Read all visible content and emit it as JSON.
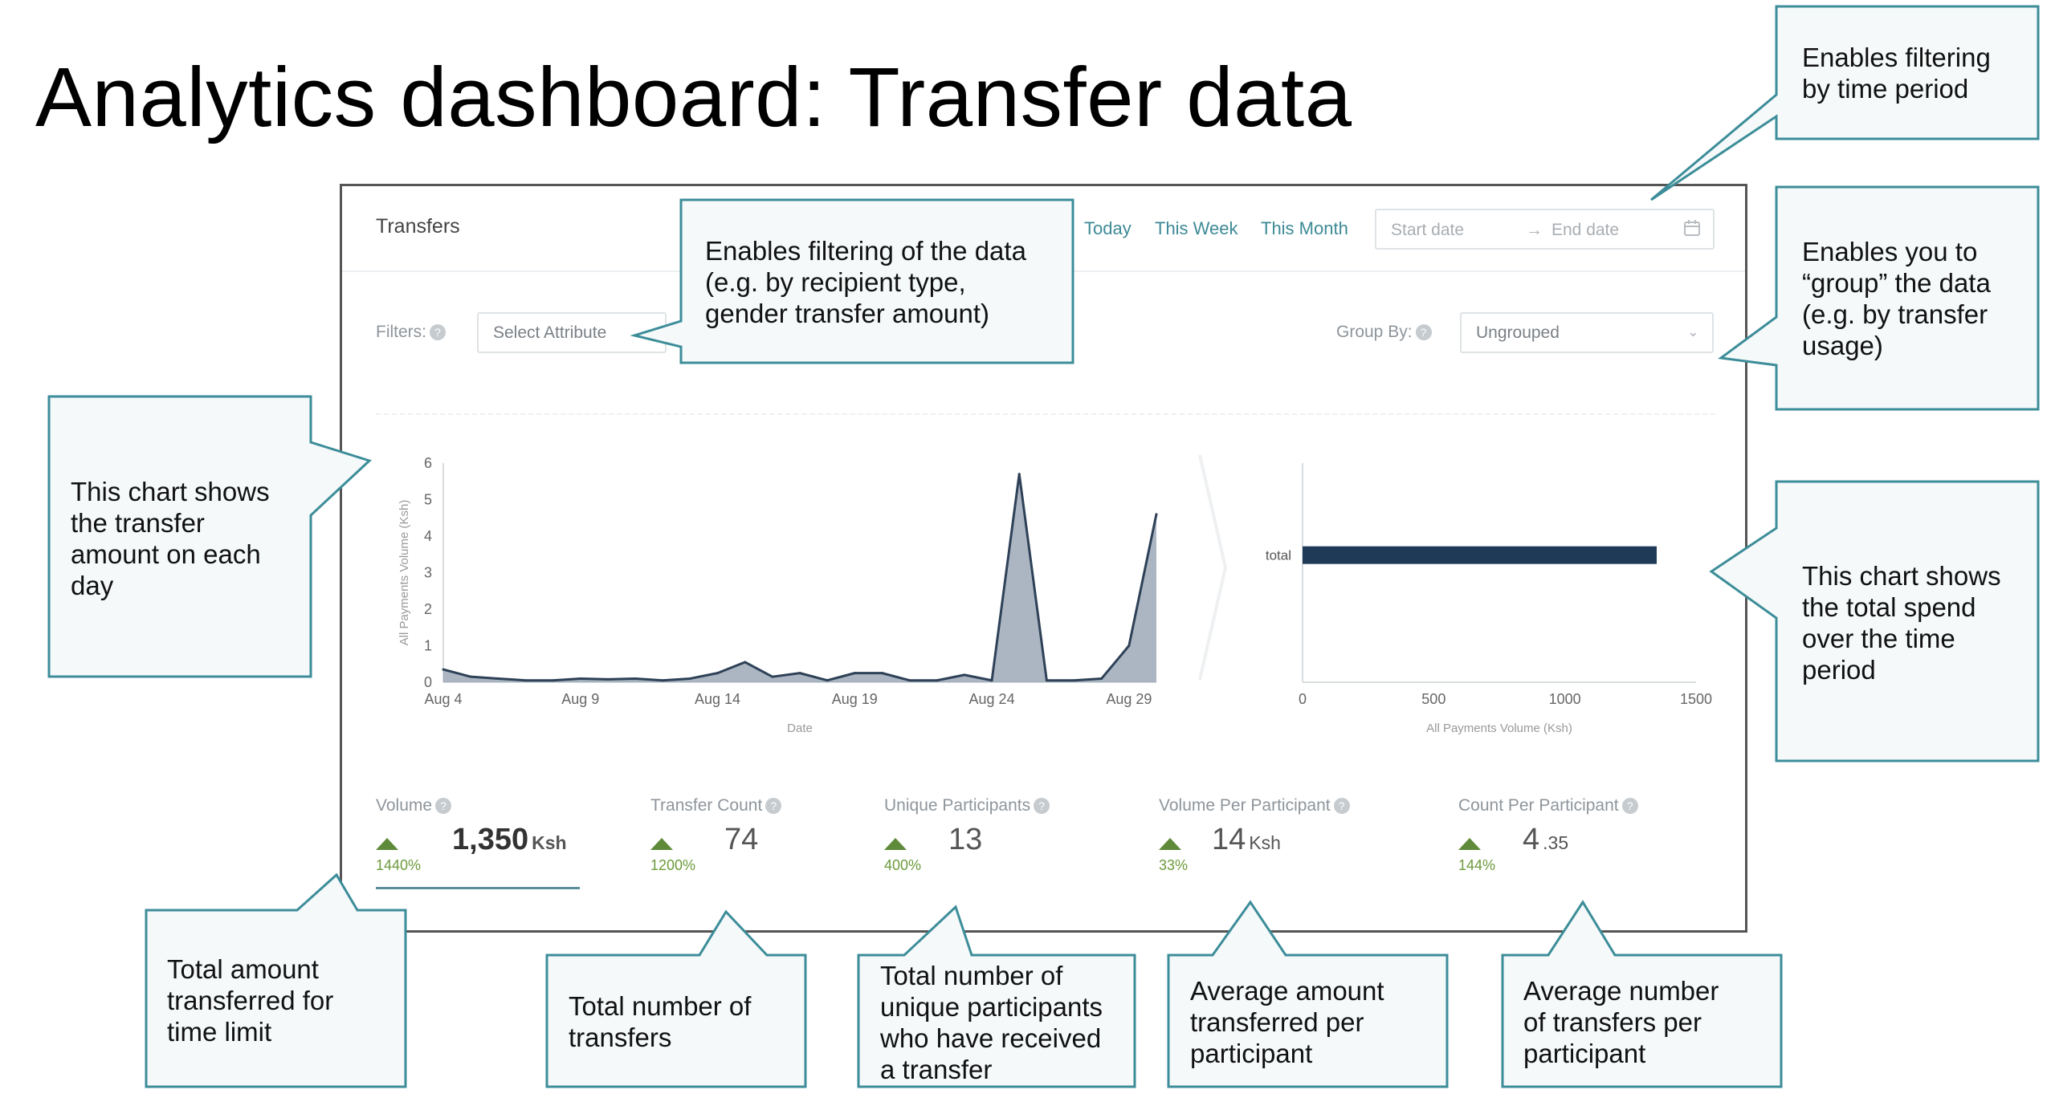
{
  "page": {
    "title": "Analytics dashboard: Transfer data"
  },
  "dashboard": {
    "title": "Transfers",
    "period_links": [
      "Today",
      "This Week",
      "This Month"
    ],
    "date_range": {
      "start_placeholder": "Start date",
      "arrow": "→",
      "end_placeholder": "End date",
      "icon": "calendar-icon"
    },
    "filters": {
      "label": "Filters:",
      "select_placeholder": "Select Attribute"
    },
    "group_by": {
      "label": "Group By:",
      "value": "Ungrouped"
    },
    "help_icon": "?"
  },
  "chart_data": [
    {
      "type": "area",
      "title": "",
      "xlabel": "Date",
      "ylabel": "All Payments Volume (Ksh)",
      "x_tick_labels": [
        "Aug 4",
        "Aug 9",
        "Aug 14",
        "Aug 19",
        "Aug 24",
        "Aug 29"
      ],
      "y_tick_labels": [
        "0",
        "1",
        "2",
        "3",
        "4",
        "5",
        "6"
      ],
      "ylim": [
        0,
        6
      ],
      "grid": false,
      "x": [
        "Aug 4",
        "Aug 5",
        "Aug 6",
        "Aug 7",
        "Aug 8",
        "Aug 9",
        "Aug 10",
        "Aug 11",
        "Aug 12",
        "Aug 13",
        "Aug 14",
        "Aug 15",
        "Aug 16",
        "Aug 17",
        "Aug 18",
        "Aug 19",
        "Aug 20",
        "Aug 21",
        "Aug 22",
        "Aug 23",
        "Aug 24",
        "Aug 25",
        "Aug 26",
        "Aug 27",
        "Aug 28",
        "Aug 29",
        "Aug 30"
      ],
      "values": [
        0.35,
        0.15,
        0.1,
        0.05,
        0.05,
        0.1,
        0.08,
        0.1,
        0.05,
        0.1,
        0.25,
        0.55,
        0.15,
        0.25,
        0.05,
        0.25,
        0.25,
        0.05,
        0.05,
        0.2,
        0.05,
        5.7,
        0.05,
        0.05,
        0.1,
        1.0,
        4.6
      ]
    },
    {
      "type": "bar",
      "orientation": "horizontal",
      "title": "",
      "xlabel": "All Payments Volume (Ksh)",
      "ylabel": "",
      "categories": [
        "total"
      ],
      "values": [
        1350
      ],
      "x_tick_labels": [
        "0",
        "500",
        "1000",
        "1500"
      ],
      "xlim": [
        0,
        1500
      ],
      "grid": false,
      "color": "#1f3a56"
    }
  ],
  "metrics": [
    {
      "label": "Volume",
      "value": "1,350",
      "unit": "Ksh",
      "change": "1440%",
      "trend": "up"
    },
    {
      "label": "Transfer Count",
      "value": "74",
      "unit": "",
      "change": "1200%",
      "trend": "up"
    },
    {
      "label": "Unique Participants",
      "value": "13",
      "unit": "",
      "change": "400%",
      "trend": "up"
    },
    {
      "label": "Volume Per Participant",
      "value": "14",
      "unit": "Ksh",
      "change": "33%",
      "trend": "up"
    },
    {
      "label": "Count Per Participant",
      "value": "4",
      "decimal": ".35",
      "unit": "",
      "change": "144%",
      "trend": "up"
    }
  ],
  "annotations": {
    "time_period": [
      "Enables filtering",
      "by time period"
    ],
    "filters": [
      "Enables filtering of the data",
      "(e.g. by recipient type,",
      "gender transfer amount)"
    ],
    "group_by": [
      "Enables you to",
      "“group”  the data",
      "(e.g. by transfer",
      "usage)"
    ],
    "daily_chart": [
      "This chart shows",
      "the transfer",
      "amount on each",
      "day"
    ],
    "total_chart": [
      "This chart shows",
      "the total spend",
      "over the time",
      "period"
    ],
    "volume": [
      "Total amount",
      "transferred for",
      "time limit"
    ],
    "transfer_count": [
      "Total number of",
      "transfers"
    ],
    "unique_participants": [
      "Total number of",
      "unique participants",
      "who have received",
      "a transfer"
    ],
    "volume_per_participant": [
      "Average amount",
      "transferred per",
      "participant"
    ],
    "count_per_participant": [
      "Average number",
      "of transfers per",
      "participant"
    ]
  },
  "colors": {
    "accent": "#3d8a96",
    "callout_fill": "#f5f9fa",
    "callout_border": "#3c8d99",
    "trend_up": "#6c9a3c",
    "area_fill": "#8f9eae",
    "line": "#2e4157"
  }
}
